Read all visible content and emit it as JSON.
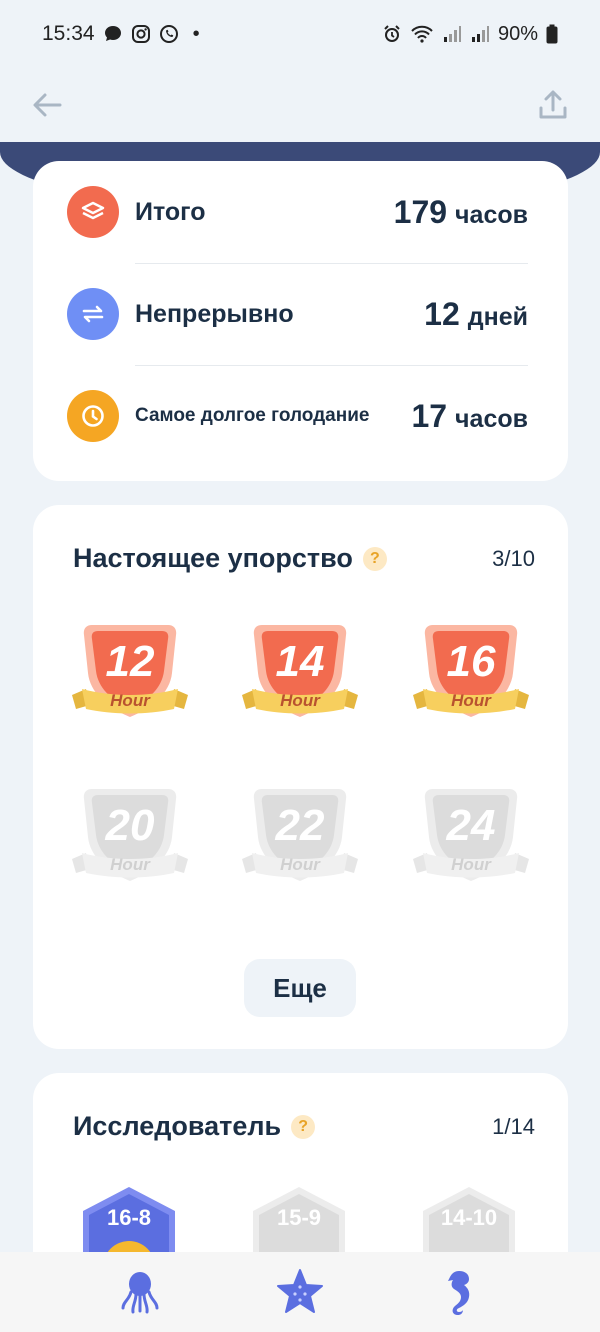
{
  "status_bar": {
    "time": "15:34",
    "dot": "•",
    "battery": "90%"
  },
  "top_bar": {
    "back_icon": "arrow-left-icon",
    "share_icon": "share-upload-icon"
  },
  "stats": [
    {
      "label": "Итого",
      "value": "179",
      "unit": "часов",
      "icon": "layers-icon",
      "color": "#f26b4f"
    },
    {
      "label": "Непрерывно",
      "value": "12",
      "unit": "дней",
      "icon": "repeat-arrows-icon",
      "color": "#6f8ff5"
    },
    {
      "label": "Самое долгое голодание",
      "value": "17",
      "unit": "часов",
      "icon": "clock-icon",
      "color": "#f5a623"
    }
  ],
  "persistence": {
    "title": "Настоящее упорство",
    "help": "?",
    "count": "3/10",
    "badges": [
      {
        "number": "12",
        "label": "Hour",
        "earned": true
      },
      {
        "number": "14",
        "label": "Hour",
        "earned": true
      },
      {
        "number": "16",
        "label": "Hour",
        "earned": true
      },
      {
        "number": "20",
        "label": "Hour",
        "earned": false
      },
      {
        "number": "22",
        "label": "Hour",
        "earned": false
      },
      {
        "number": "24",
        "label": "Hour",
        "earned": false
      }
    ],
    "more_label": "Еще"
  },
  "explorer": {
    "title": "Исследователь",
    "help": "?",
    "count": "1/14",
    "badges": [
      {
        "label": "16-8",
        "earned": true
      },
      {
        "label": "15-9",
        "earned": false
      },
      {
        "label": "14-10",
        "earned": false
      }
    ]
  },
  "bottom_nav": [
    {
      "icon": "octopus-icon"
    },
    {
      "icon": "starfish-icon"
    },
    {
      "icon": "seahorse-icon"
    }
  ],
  "colors": {
    "accent": "#5b6ee0",
    "badge_orange": "#f26b4f",
    "ribbon_yellow": "#f7cf5e",
    "locked_gray": "#dcdcdc"
  }
}
